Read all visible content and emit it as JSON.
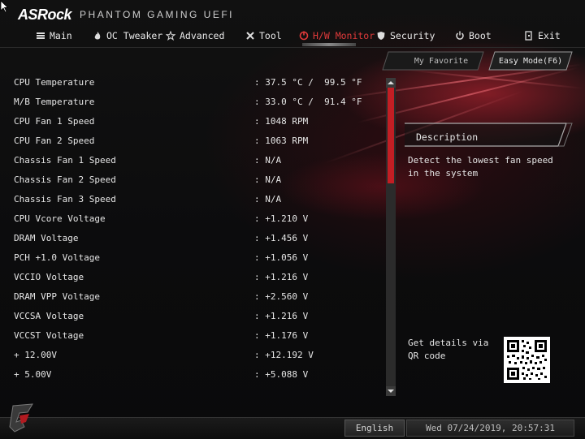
{
  "brand": {
    "logo": "ASRock",
    "subtitle": "PHANTOM GAMING UEFI"
  },
  "menu": [
    {
      "label": "Main",
      "icon": "list-icon",
      "active": false
    },
    {
      "label": "OC Tweaker",
      "icon": "flame-icon",
      "active": false
    },
    {
      "label": "Advanced",
      "icon": "star-icon",
      "active": false
    },
    {
      "label": "Tool",
      "icon": "tools-icon",
      "active": false
    },
    {
      "label": "H/W Monitor",
      "icon": "monitor-icon",
      "active": true
    },
    {
      "label": "Security",
      "icon": "shield-icon",
      "active": false
    },
    {
      "label": "Boot",
      "icon": "power-icon",
      "active": false
    },
    {
      "label": "Exit",
      "icon": "exit-icon",
      "active": false
    }
  ],
  "buttons": {
    "favorite": "My Favorite",
    "easy_mode": "Easy Mode(F6)"
  },
  "hw_rows": [
    {
      "label": "CPU Temperature",
      "value": ": 37.5 °C /  99.5 °F"
    },
    {
      "label": "M/B Temperature",
      "value": ": 33.0 °C /  91.4 °F"
    },
    {
      "label": "CPU Fan 1 Speed",
      "value": ": 1048 RPM"
    },
    {
      "label": "CPU Fan 2 Speed",
      "value": ": 1063 RPM"
    },
    {
      "label": "Chassis Fan 1 Speed",
      "value": ": N/A"
    },
    {
      "label": "Chassis Fan 2 Speed",
      "value": ": N/A"
    },
    {
      "label": "Chassis Fan 3 Speed",
      "value": ": N/A"
    },
    {
      "label": "CPU Vcore Voltage",
      "value": ": +1.210 V"
    },
    {
      "label": "DRAM Voltage",
      "value": ": +1.456 V"
    },
    {
      "label": "PCH +1.0 Voltage",
      "value": ": +1.056 V"
    },
    {
      "label": "VCCIO Voltage",
      "value": ": +1.216 V"
    },
    {
      "label": "DRAM VPP Voltage",
      "value": ": +2.560 V"
    },
    {
      "label": "VCCSA Voltage",
      "value": ": +1.216 V"
    },
    {
      "label": "VCCST Voltage",
      "value": ": +1.176 V"
    },
    {
      "label": "+ 12.00V",
      "value": ": +12.192 V"
    },
    {
      "label": "+ 5.00V",
      "value": ": +5.088 V"
    }
  ],
  "description": {
    "title": "Description",
    "text": "Detect the lowest fan speed in the system",
    "qr_text": "Get details via QR code"
  },
  "footer": {
    "language": "English",
    "datetime": "Wed 07/24/2019, 20:57:31"
  },
  "colors": {
    "accent": "#c21e24",
    "active_menu": "#e03a3a",
    "background": "#0b0b0c"
  }
}
